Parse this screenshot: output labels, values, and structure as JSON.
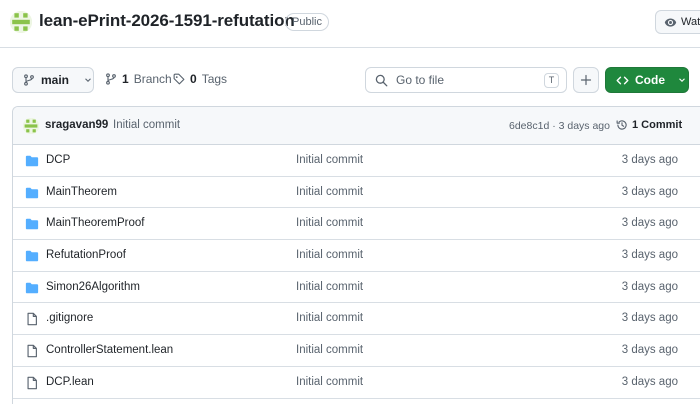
{
  "repo": {
    "name": "lean-ePrint-2026-1591-refutation",
    "visibility": "Public",
    "watch_label": "Watch"
  },
  "toolbar": {
    "branch": "main",
    "branch_count": "1",
    "branch_label": "Branch",
    "tag_count": "0",
    "tag_label": "Tags",
    "goto_placeholder": "Go to file",
    "goto_shortcut": "T",
    "code_label": "Code"
  },
  "latest_commit": {
    "author": "sragavan99",
    "message": "Initial commit",
    "meta": "6de8c1d · 3 days ago",
    "count": "1 Commit"
  },
  "files": [
    {
      "name": "DCP",
      "type": "folder",
      "message": "Initial commit",
      "date": "3 days ago"
    },
    {
      "name": "MainTheorem",
      "type": "folder",
      "message": "Initial commit",
      "date": "3 days ago"
    },
    {
      "name": "MainTheoremProof",
      "type": "folder",
      "message": "Initial commit",
      "date": "3 days ago"
    },
    {
      "name": "RefutationProof",
      "type": "folder",
      "message": "Initial commit",
      "date": "3 days ago"
    },
    {
      "name": "Simon26Algorithm",
      "type": "folder",
      "message": "Initial commit",
      "date": "3 days ago"
    },
    {
      "name": ".gitignore",
      "type": "file",
      "message": "Initial commit",
      "date": "3 days ago"
    },
    {
      "name": "ControllerStatement.lean",
      "type": "file",
      "message": "Initial commit",
      "date": "3 days ago"
    },
    {
      "name": "DCP.lean",
      "type": "file",
      "message": "Initial commit",
      "date": "3 days ago"
    }
  ],
  "colors": {
    "folder": "#54aeff",
    "code_button": "#1f883d",
    "avatar_green": "#8bc34a"
  }
}
